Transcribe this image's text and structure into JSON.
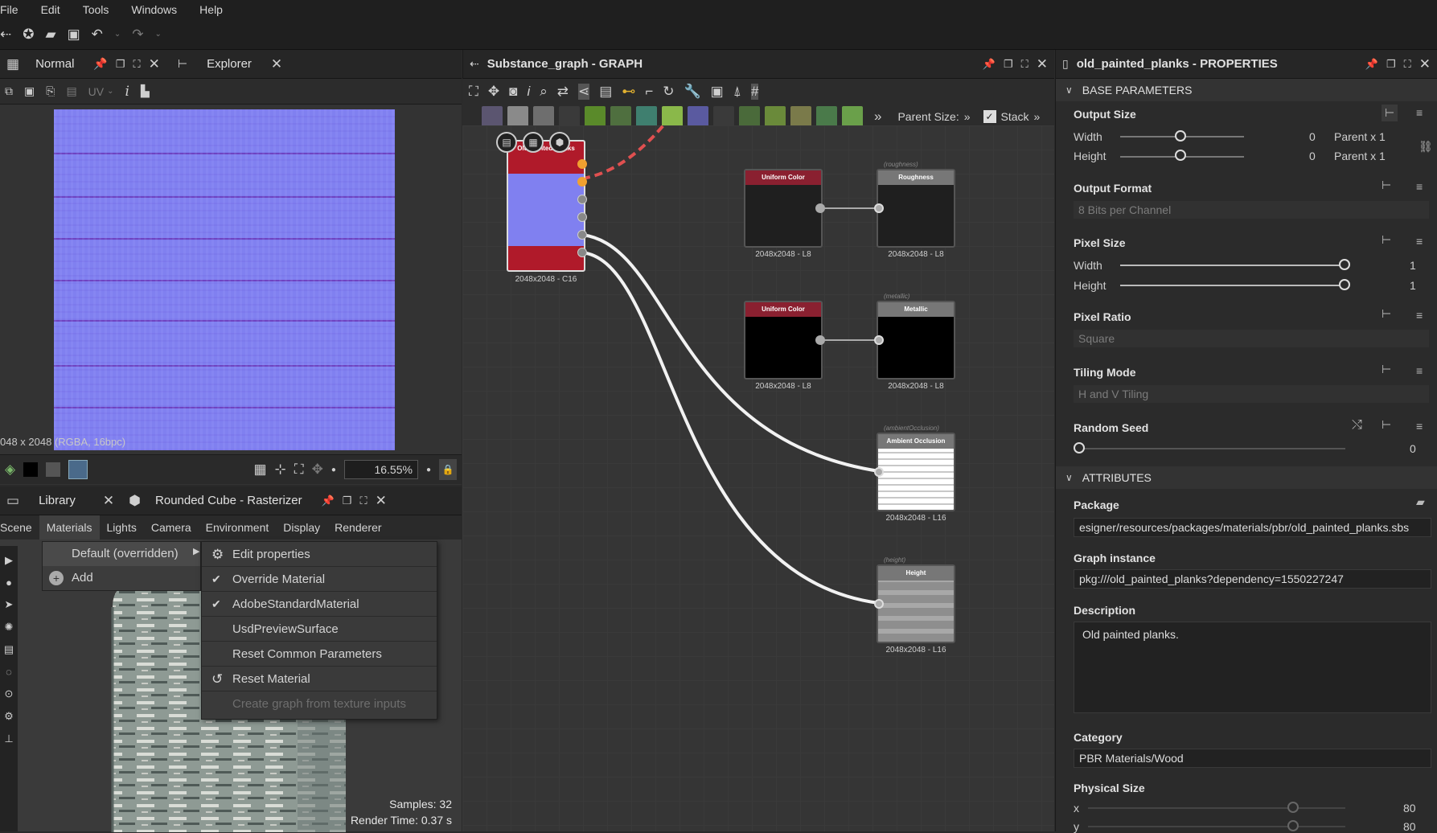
{
  "menu": {
    "items": [
      "File",
      "Edit",
      "Tools",
      "Windows",
      "Help"
    ]
  },
  "viewer2d": {
    "tab_title": "Normal",
    "tab2_title": "Explorer",
    "uv_label": "UV",
    "resolution_info": "048 x 2048 (RGBA, 16bpc)",
    "zoom": "16.55%"
  },
  "scene3d": {
    "tab_library": "Library",
    "tab_title": "Rounded Cube - Rasterizer",
    "tabs": [
      "Scene",
      "Materials",
      "Lights",
      "Camera",
      "Environment",
      "Display",
      "Renderer"
    ],
    "submenu": {
      "items": [
        "Default (overridden)",
        "Add"
      ]
    },
    "context_menu": {
      "items": [
        "Edit properties",
        "Override Material",
        "AdobeStandardMaterial",
        "UsdPreviewSurface",
        "Reset Common Parameters",
        "Reset Material",
        "Create graph from texture inputs"
      ]
    },
    "samples": "Samples: 32",
    "render_time": "Render Time: 0.37 s"
  },
  "graph": {
    "title": "Substance_graph - GRAPH",
    "parent_size_label": "Parent Size:",
    "stack_label": "Stack",
    "nodes": {
      "main": {
        "title": "Old painted planks",
        "size": "2048x2048 - C16"
      },
      "uc1": {
        "title": "Uniform Color",
        "size": "2048x2048 - L8"
      },
      "rough": {
        "title": "Roughness",
        "tag": "(roughness)",
        "size": "2048x2048 - L8"
      },
      "uc2": {
        "title": "Uniform Color",
        "size": "2048x2048 - L8"
      },
      "metal": {
        "title": "Metallic",
        "tag": "(metallic)",
        "size": "2048x2048 - L8"
      },
      "ao": {
        "title": "Ambient Occlusion",
        "tag": "(ambientOcclusion)",
        "size": "2048x2048 - L16"
      },
      "height": {
        "title": "Height",
        "tag": "(height)",
        "size": "2048x2048 - L16"
      }
    }
  },
  "properties": {
    "title": "old_painted_planks - PROPERTIES",
    "sec_base": "BASE PARAMETERS",
    "output_size": {
      "label": "Output Size",
      "width_label": "Width",
      "height_label": "Height",
      "width_value": "0",
      "height_value": "0",
      "width_mode": "Parent x 1",
      "height_mode": "Parent x 1"
    },
    "output_format": {
      "label": "Output Format",
      "value": "8 Bits per Channel"
    },
    "pixel_size": {
      "label": "Pixel Size",
      "width_label": "Width",
      "height_label": "Height",
      "width_value": "1",
      "height_value": "1"
    },
    "pixel_ratio": {
      "label": "Pixel Ratio",
      "value": "Square"
    },
    "tiling_mode": {
      "label": "Tiling Mode",
      "value": "H and V Tiling"
    },
    "random_seed": {
      "label": "Random Seed",
      "value": "0"
    },
    "sec_attr": "ATTRIBUTES",
    "package": {
      "label": "Package",
      "value": "esigner/resources/packages/materials/pbr/old_painted_planks.sbs"
    },
    "graph_instance": {
      "label": "Graph instance",
      "value": "pkg:///old_painted_planks?dependency=1550227247"
    },
    "description": {
      "label": "Description",
      "value": "Old painted planks."
    },
    "category": {
      "label": "Category",
      "value": "PBR Materials/Wood"
    },
    "physical_size": {
      "label": "Physical Size",
      "x_label": "x",
      "y_label": "y",
      "x_value": "80",
      "y_value": "80"
    }
  }
}
